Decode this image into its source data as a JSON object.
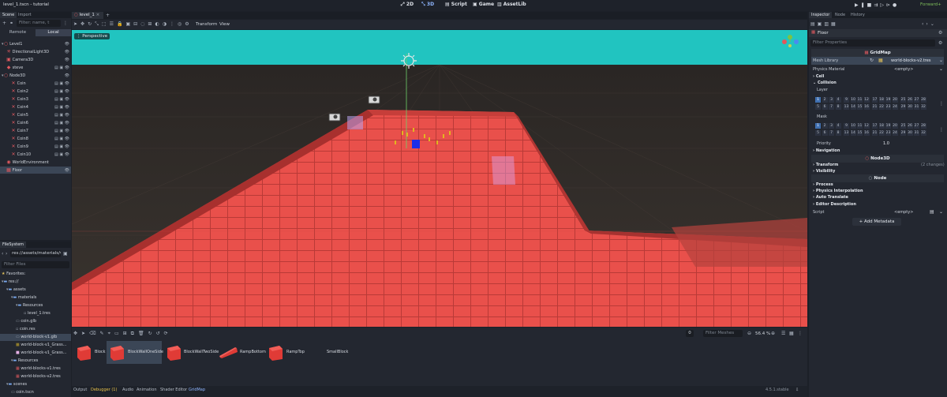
{
  "app": {
    "title": "level_1.tscn - tutorial",
    "renderer": "Forward+"
  },
  "main_tabs": [
    {
      "label": "2D"
    },
    {
      "label": "3D"
    },
    {
      "label": "Script"
    },
    {
      "label": "Game"
    },
    {
      "label": "AssetLib"
    }
  ],
  "scene_panel": {
    "tabs": [
      "Scene",
      "Import"
    ],
    "filter_placeholder": "Filter: name, t",
    "remote_label": "Remote",
    "local_label": "Local",
    "nodes": [
      {
        "label": "Level1",
        "icon": "node3d-icon"
      },
      {
        "label": "DirectionalLight3D",
        "icon": "light-icon"
      },
      {
        "label": "Camera3D",
        "icon": "camera-icon"
      },
      {
        "label": "steve",
        "icon": "character-icon"
      },
      {
        "label": "Node3D",
        "icon": "node3d-icon"
      },
      {
        "label": "Coin",
        "icon": "coin-icon"
      },
      {
        "label": "Coin2",
        "icon": "coin-icon"
      },
      {
        "label": "Coin3",
        "icon": "coin-icon"
      },
      {
        "label": "Coin4",
        "icon": "coin-icon"
      },
      {
        "label": "Coin5",
        "icon": "coin-icon"
      },
      {
        "label": "Coin6",
        "icon": "coin-icon"
      },
      {
        "label": "Coin7",
        "icon": "coin-icon"
      },
      {
        "label": "Coin8",
        "icon": "coin-icon"
      },
      {
        "label": "Coin9",
        "icon": "coin-icon"
      },
      {
        "label": "Coin10",
        "icon": "coin-icon"
      },
      {
        "label": "WorldEnvironment",
        "icon": "environment-icon"
      },
      {
        "label": "Floor",
        "icon": "gridmap-icon"
      }
    ]
  },
  "filesystem": {
    "tab": "FileSystem",
    "path": "res://assets/materials/w",
    "filter_placeholder": "Filter Files",
    "items": [
      {
        "label": "Favorites:"
      },
      {
        "label": "res://"
      },
      {
        "label": "assets"
      },
      {
        "label": "materials"
      },
      {
        "label": "Resources"
      },
      {
        "label": "level_1.tres"
      },
      {
        "label": "coin.glb"
      },
      {
        "label": "coin.res"
      },
      {
        "label": "world-block-v1.glb"
      },
      {
        "label": "world-block-v1_Grass..."
      },
      {
        "label": "world-block-v1_Grass..."
      },
      {
        "label": "Resources"
      },
      {
        "label": "world-blocks-v1.tres"
      },
      {
        "label": "world-blocks-v2.tres"
      },
      {
        "label": "scenes"
      },
      {
        "label": "coin.tscn"
      }
    ]
  },
  "editor": {
    "tab": "level_1",
    "toolbar_menus": [
      "Transform",
      "View"
    ],
    "perspective": "Perspective"
  },
  "gridmap_panel": {
    "filter_placeholder": "Filter Meshes",
    "zoom": "56.4 %",
    "items": [
      {
        "label": "Block"
      },
      {
        "label": "BlockWallOneSide"
      },
      {
        "label": "BlockWallTwoSide"
      },
      {
        "label": "RampBottom"
      },
      {
        "label": "RampTop"
      },
      {
        "label": "SmallBlock"
      }
    ]
  },
  "bottom_tabs": [
    "Output",
    "Debugger (1)",
    "Audio",
    "Animation",
    "Shader Editor",
    "GridMap"
  ],
  "version": "4.5.1.stable",
  "inspector": {
    "tabs": [
      "Inspector",
      "Node",
      "History"
    ],
    "object": "Floor",
    "filter_placeholder": "Filter Properties",
    "class_header": "GridMap",
    "mesh_library_label": "Mesh Library",
    "mesh_library_value": "world-blocks-v2.tres",
    "physics_material_label": "Physics Material",
    "empty_value": "<empty>",
    "cell_label": "Cell",
    "collision_label": "Collision",
    "layer_label": "Layer",
    "mask_label": "Mask",
    "layer_row1": [
      "1",
      "2",
      "3",
      "4",
      "9",
      "10",
      "11",
      "12",
      "17",
      "18",
      "19",
      "20",
      "25",
      "26",
      "27",
      "28"
    ],
    "layer_row2": [
      "5",
      "6",
      "7",
      "8",
      "13",
      "14",
      "15",
      "16",
      "21",
      "22",
      "23",
      "24",
      "29",
      "30",
      "31",
      "32"
    ],
    "priority_label": "Priority",
    "priority_value": "1.0",
    "navigation_label": "Navigation",
    "node3d_header": "Node3D",
    "transform_label": "Transform",
    "transform_changes": "(2 changes)",
    "visibility_label": "Visibility",
    "node_header": "Node",
    "process_label": "Process",
    "physics_interp_label": "Physics Interpolation",
    "auto_translate_label": "Auto Translate",
    "editor_desc_label": "Editor Description",
    "script_label": "Script",
    "add_metadata": "Add Metadata"
  }
}
